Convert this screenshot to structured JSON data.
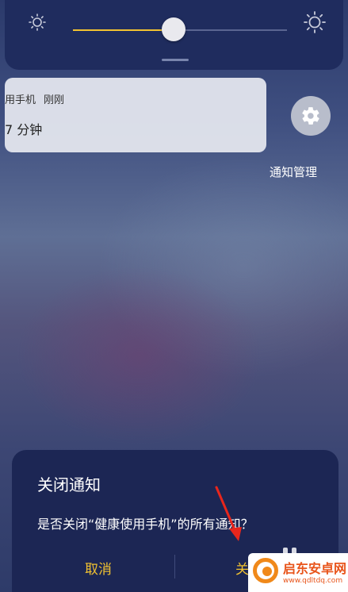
{
  "quick_settings": {
    "tiles": [
      {
        "state": "on",
        "color": "#f2c231"
      },
      {
        "state": "off"
      },
      {
        "state": "off"
      },
      {
        "state": "on",
        "color": "#f2c231"
      },
      {
        "state": "off"
      }
    ],
    "brightness": {
      "level_percent": 47,
      "low_icon": "sun-dim-icon",
      "high_icon": "sun-bright-icon",
      "accent": "#f2c231"
    }
  },
  "notification": {
    "app_name": "用手机",
    "time": "刚刚",
    "body": "7 分钟"
  },
  "notification_manage": {
    "icon": "gear-icon",
    "label": "通知管理"
  },
  "dialog": {
    "title": "关闭通知",
    "message": "是否关闭“健康使用手机”的所有通知？",
    "cancel_label": "取消",
    "confirm_label": "关闭",
    "button_color": "#f2c231"
  },
  "watermark": {
    "logo_icon": "qidian-logo-icon",
    "name": "启东安卓网",
    "url": "www.qdltdq.com"
  }
}
